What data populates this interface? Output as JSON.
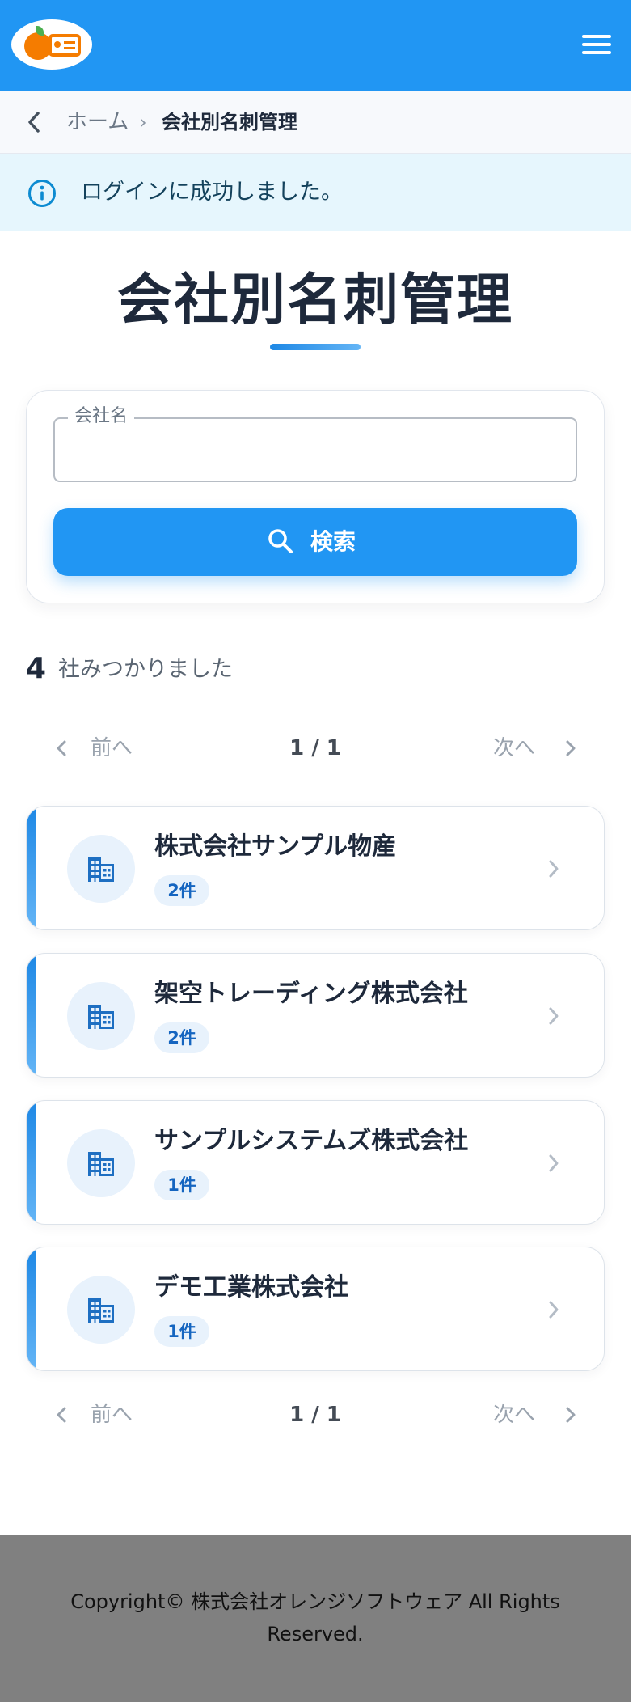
{
  "header": {
    "logo_icon": "orange-business-card-logo",
    "menu_icon": "hamburger-menu-icon",
    "color": "#2196f3"
  },
  "breadcrumb": {
    "back_icon": "chevron-left-icon",
    "home": "ホーム",
    "separator": "›",
    "current": "会社別名刺管理"
  },
  "alert": {
    "icon": "info-icon",
    "message": "ログインに成功しました。"
  },
  "page": {
    "title": "会社別名刺管理"
  },
  "search": {
    "label": "会社名",
    "value": "",
    "button_label": "検索",
    "button_icon": "search-icon"
  },
  "results": {
    "count": "4",
    "count_suffix": "社みつかりました"
  },
  "pagination": {
    "prev_label": "前へ",
    "next_label": "次へ",
    "indicator": "1 / 1"
  },
  "companies": [
    {
      "name": "株式会社サンプル物産",
      "count": "2件"
    },
    {
      "name": "架空トレーディング株式会社",
      "count": "2件"
    },
    {
      "name": "サンプルシステムズ株式会社",
      "count": "1件"
    },
    {
      "name": "デモ工業株式会社",
      "count": "1件"
    }
  ],
  "footer": {
    "copyright": "Copyright© 株式会社オレンジソフトウェア All Rights Reserved."
  }
}
